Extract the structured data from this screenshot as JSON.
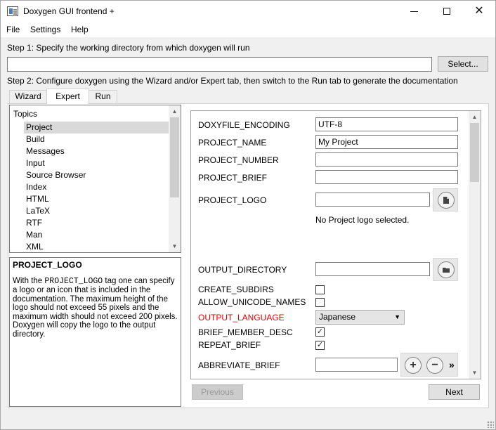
{
  "window": {
    "title": "Doxygen GUI frontend +"
  },
  "menu": {
    "file": "File",
    "settings": "Settings",
    "help": "Help"
  },
  "step1": {
    "label": "Step 1: Specify the working directory from which doxygen will run",
    "value": "",
    "select_label": "Select..."
  },
  "step2": {
    "label": "Step 2: Configure doxygen using the Wizard and/or Expert tab, then switch to the Run tab to generate the documentation"
  },
  "tabs": [
    {
      "label": "Wizard"
    },
    {
      "label": "Expert"
    },
    {
      "label": "Run"
    }
  ],
  "topics": {
    "header": "Topics",
    "items": [
      "Project",
      "Build",
      "Messages",
      "Input",
      "Source Browser",
      "Index",
      "HTML",
      "LaTeX",
      "RTF",
      "Man",
      "XML"
    ],
    "selected": "Project"
  },
  "help": {
    "title": "PROJECT_LOGO",
    "text_before": "With the ",
    "tag": "PROJECT_LOGO",
    "text_after": " tag one can specify a logo or an icon that is included in the documentation. The maximum height of the logo should not exceed 55 pixels and the maximum width should not exceed 200 pixels. Doxygen will copy the logo to the output directory."
  },
  "options": {
    "doxyfile_encoding": {
      "label": "DOXYFILE_ENCODING",
      "value": "UTF-8"
    },
    "project_name": {
      "label": "PROJECT_NAME",
      "value": "My Project"
    },
    "project_number": {
      "label": "PROJECT_NUMBER",
      "value": ""
    },
    "project_brief": {
      "label": "PROJECT_BRIEF",
      "value": ""
    },
    "project_logo": {
      "label": "PROJECT_LOGO",
      "value": "",
      "info": "No Project logo selected."
    },
    "output_directory": {
      "label": "OUTPUT_DIRECTORY",
      "value": ""
    },
    "create_subdirs": {
      "label": "CREATE_SUBDIRS",
      "checked": false
    },
    "allow_unicode_names": {
      "label": "ALLOW_UNICODE_NAMES",
      "checked": false
    },
    "output_language": {
      "label": "OUTPUT_LANGUAGE",
      "value": "Japanese",
      "label_color": "#e00000"
    },
    "brief_member_desc": {
      "label": "BRIEF_MEMBER_DESC",
      "checked": true
    },
    "repeat_brief": {
      "label": "REPEAT_BRIEF",
      "checked": true
    },
    "abbreviate_brief": {
      "label": "ABBREVIATE_BRIEF",
      "value": "",
      "more": "»"
    }
  },
  "nav": {
    "previous_label": "Previous",
    "next_label": "Next"
  },
  "icons": {
    "file": "file-icon",
    "folder": "folder-icon",
    "add": "plus-icon",
    "remove": "minus-icon",
    "check": "✓"
  }
}
